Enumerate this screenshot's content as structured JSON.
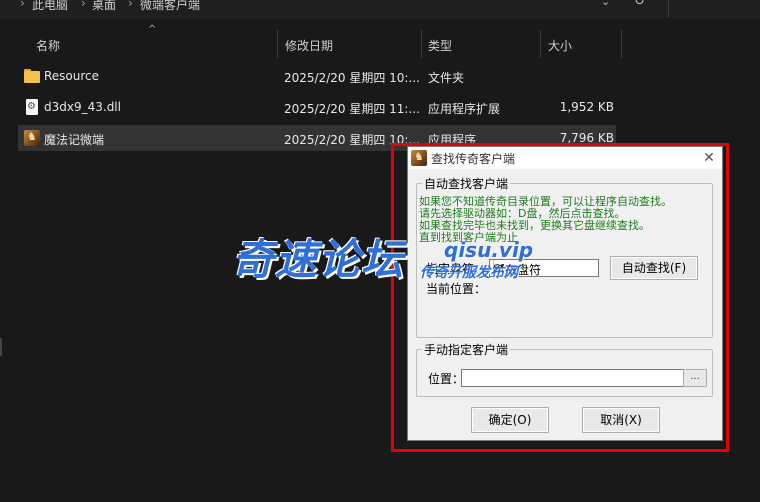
{
  "breadcrumb": {
    "items": [
      "此电脑",
      "桌面",
      "微端客户端"
    ]
  },
  "columns": {
    "name": "名称",
    "date": "修改日期",
    "type": "类型",
    "size": "大小"
  },
  "files": [
    {
      "name": "Resource",
      "date": "2025/2/20 星期四 10:...",
      "type": "文件夹",
      "size": "",
      "icon": "folder-icon"
    },
    {
      "name": "d3dx9_43.dll",
      "date": "2025/2/20 星期四 11:...",
      "type": "应用程序扩展",
      "size": "1,952 KB",
      "icon": "dll-file-icon"
    },
    {
      "name": "魔法记微端",
      "date": "2025/2/20 星期四 10:...",
      "type": "应用程序",
      "size": "7,796 KB",
      "icon": "app-icon"
    }
  ],
  "dialog": {
    "title": "查找传奇客户端",
    "auto_group": "自动查找客户端",
    "info_lines": [
      "如果您不知道传奇目录位置，可以让程序自动查找。",
      "请先选择驱动器如：D盘，然后点击查找。",
      "如果查找完毕也未找到，更换其它盘继续查找。",
      "直到找到客户端为止"
    ],
    "drive_label": "指定盘符：",
    "drive_value": "所有盘符",
    "auto_find_button": "自动查找(F)",
    "current_location_label": "当前位置：",
    "manual_group": "手动指定客户端",
    "location_label": "位置：",
    "location_value": "",
    "browse_label": "...",
    "ok_button": "确定(O)",
    "cancel_button": "取消(X)"
  },
  "watermark": {
    "main": "奇速论坛",
    "domain": "qisu.vip",
    "sub": "传奇开服发布网"
  },
  "colors": {
    "highlight": "#e0000f",
    "info_text": "#1f7a1f",
    "watermark": "#2e6fd8"
  }
}
